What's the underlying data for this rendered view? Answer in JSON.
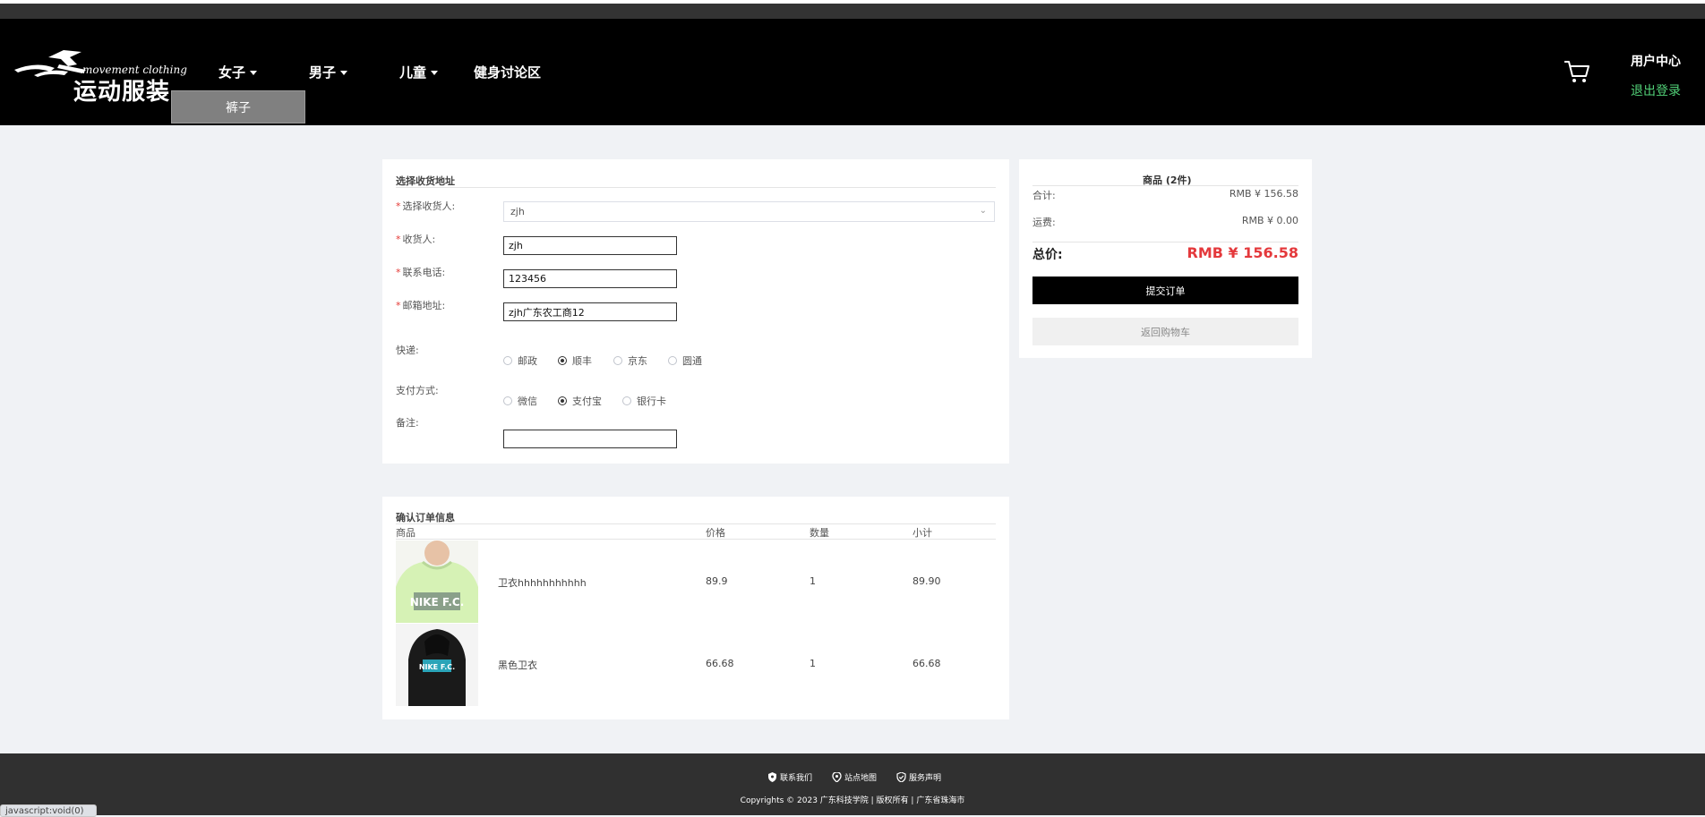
{
  "header": {
    "logo_en": "movement clothing",
    "logo_cn": "运动服装",
    "nav": [
      {
        "label": "女子",
        "dropdown": true
      },
      {
        "label": "男子",
        "dropdown": true
      },
      {
        "label": "儿童",
        "dropdown": true
      },
      {
        "label": "健身讨论区",
        "dropdown": false
      }
    ],
    "dropdown_open_item": "裤子",
    "user_center": "用户中心",
    "logout": "退出登录"
  },
  "address": {
    "title": "选择收货地址",
    "select_label": "选择收货人:",
    "select_value": "zjh",
    "name_label": "收货人:",
    "name_value": "zjh",
    "phone_label": "联系电话:",
    "phone_value": "123456",
    "addr_label": "邮箱地址:",
    "addr_value": "zjh广东农工商12",
    "express_label": "快递:",
    "express_options": [
      "邮政",
      "顺丰",
      "京东",
      "圆通"
    ],
    "express_selected": "顺丰",
    "pay_label": "支付方式:",
    "pay_options": [
      "微信",
      "支付宝",
      "银行卡"
    ],
    "pay_selected": "支付宝",
    "remark_label": "备注:",
    "remark_value": ""
  },
  "summary": {
    "title": "商品 (2件)",
    "subtotal_label": "合计:",
    "subtotal_value": "RMB ¥ 156.58",
    "shipping_label": "运费:",
    "shipping_value": "RMB ¥ 0.00",
    "total_label": "总价:",
    "total_value": "RMB ¥ 156.58",
    "submit": "提交订单",
    "back": "返回购物车"
  },
  "order": {
    "title": "确认订单信息",
    "columns": [
      "商品",
      "价格",
      "数量",
      "小计"
    ],
    "rows": [
      {
        "name": "卫衣hhhhhhhhhhh",
        "price": "89.9",
        "qty": "1",
        "subtotal": "89.90",
        "thumb_text": "NIKE F.C.",
        "thumb_color": "#d6f2b5"
      },
      {
        "name": "黑色卫衣",
        "price": "66.68",
        "qty": "1",
        "subtotal": "66.68",
        "thumb_text": "NIKE F.C.",
        "thumb_color": "#1a1a1a"
      }
    ]
  },
  "footer": {
    "contact": "联系我们",
    "sitemap": "站点地图",
    "service": "服务声明",
    "copyright": "Copyrights © 2023 广东科技学院 | 版权所有 | 广东省珠海市"
  },
  "status_url": "javascript:void(0)",
  "colors": {
    "header_bg": "#000000",
    "accent_red": "#e4393c",
    "logout_green": "#52d178",
    "footer_bg": "#303030"
  }
}
